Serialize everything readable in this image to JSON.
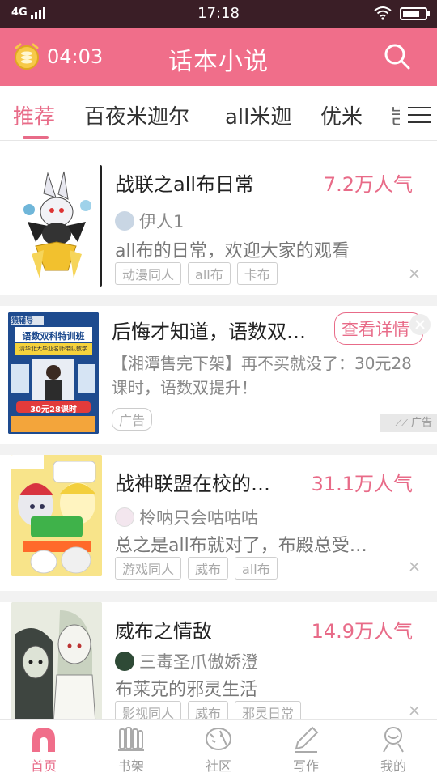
{
  "status_bar": {
    "network": "4G",
    "time": "17:18"
  },
  "header": {
    "timer": "04:03",
    "title": "话本小说",
    "icons": [
      "alarm-icon",
      "search-icon"
    ]
  },
  "tabs": [
    {
      "label": "推荐",
      "active": true
    },
    {
      "label": "百夜米迦尔",
      "active": false
    },
    {
      "label": "all米迦",
      "active": false
    },
    {
      "label": "优米",
      "active": false
    },
    {
      "label": "岂",
      "active": false
    }
  ],
  "feed": {
    "items": [
      {
        "title": "战联之all布日常",
        "popularity": "7.2万人气",
        "author": "伊人1",
        "description": "all布的日常，欢迎大家的观看",
        "tags": [
          "动漫同人",
          "all布",
          "卡布"
        ]
      },
      {
        "title": "战神联盟在校的…",
        "popularity": "31.1万人气",
        "author": "柃呐只会咕咕咕",
        "description": "总之是all布就对了，布殿总受…",
        "tags": [
          "游戏同人",
          "威布",
          "all布"
        ]
      },
      {
        "title": "威布之情敌",
        "popularity": "14.9万人气",
        "author": "三毒圣爪傲娇澄",
        "description": "布莱克的邪灵生活",
        "tags": [
          "影视同人",
          "威布",
          "邪灵日常"
        ]
      }
    ],
    "ad": {
      "title": "后悔才知道，语数双…",
      "button": "查看详情",
      "description": "【湘潭售完下架】再不买就没了：30元28课时，语数双提升！",
      "badge": "广告",
      "corner_label": "广告",
      "cover": {
        "brand": "猿辅导",
        "headline": "语数双科特训班",
        "sub": "清华北大毕业名师带队教学",
        "price_line": "30元28课时"
      }
    }
  },
  "bottom_nav": [
    {
      "label": "首页",
      "icon": "home-icon",
      "active": true
    },
    {
      "label": "书架",
      "icon": "bookshelf-icon",
      "active": false
    },
    {
      "label": "社区",
      "icon": "community-icon",
      "active": false
    },
    {
      "label": "写作",
      "icon": "pen-icon",
      "active": false
    },
    {
      "label": "我的",
      "icon": "profile-icon",
      "active": false
    }
  ],
  "colors": {
    "accent": "#e86b88",
    "header_bg": "#f06e8a",
    "status_bg": "#3a1e26"
  }
}
